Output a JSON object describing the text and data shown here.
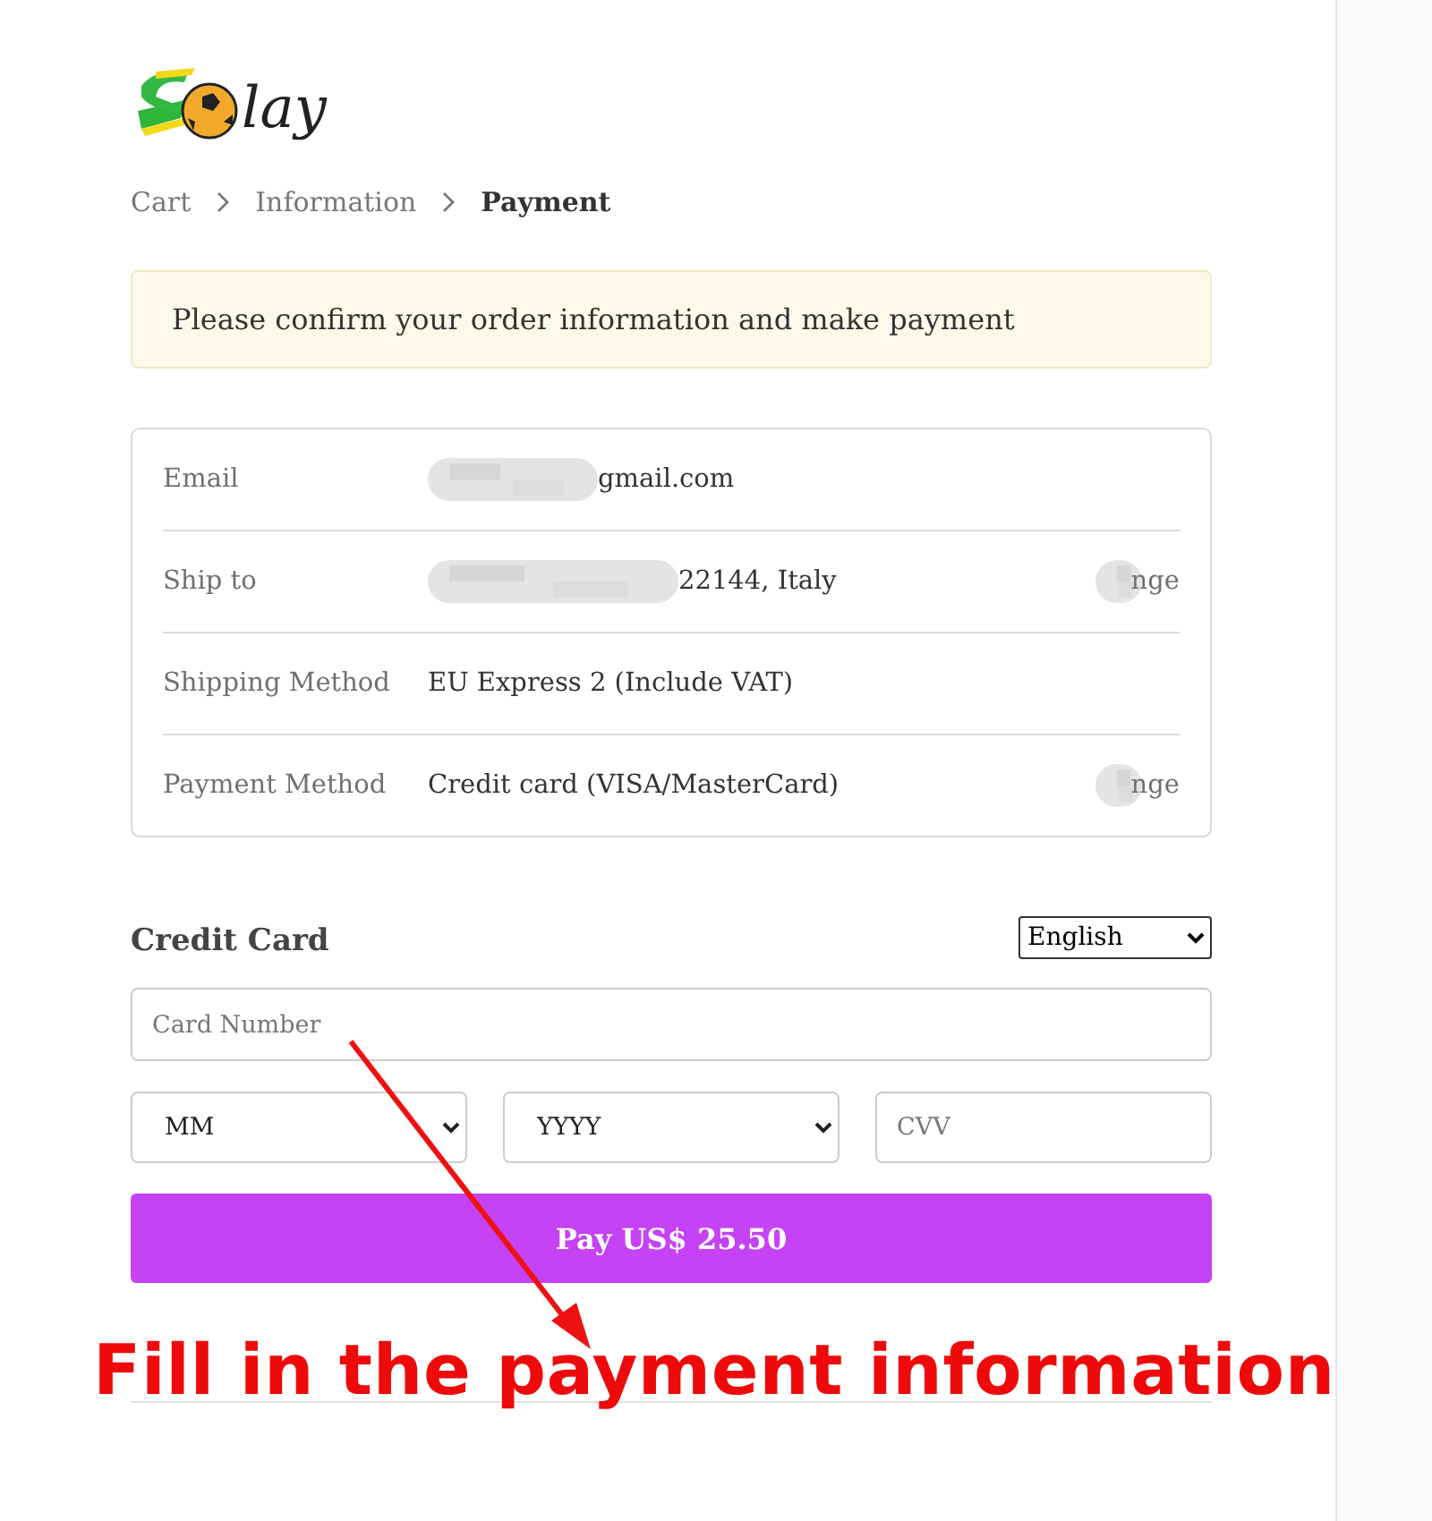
{
  "logo": {
    "text": "lay"
  },
  "breadcrumb": [
    {
      "label": "Cart",
      "current": false
    },
    {
      "label": "Information",
      "current": false
    },
    {
      "label": "Payment",
      "current": true
    }
  ],
  "notice": "Please confirm your order information and make payment",
  "summary": [
    {
      "label": "Email",
      "value": "gmail.com",
      "redacted": true
    },
    {
      "label": "Ship to",
      "value": "22144, Italy",
      "redacted": true,
      "action": "nge"
    },
    {
      "label": "Shipping Method",
      "value": "EU Express 2 (Include VAT)",
      "redacted": false
    },
    {
      "label": "Payment Method",
      "value": "Credit card (VISA/MasterCard)",
      "redacted": false,
      "action": "nge"
    }
  ],
  "credit_card": {
    "title": "Credit Card",
    "language": "English",
    "card_number": {
      "placeholder": "Card Number"
    },
    "month": "MM",
    "year": "YYYY",
    "cvv": {
      "placeholder": "CVV"
    },
    "pay_button": "Pay US$ 25.50"
  },
  "annotation": {
    "text": "Fill in the payment information"
  }
}
